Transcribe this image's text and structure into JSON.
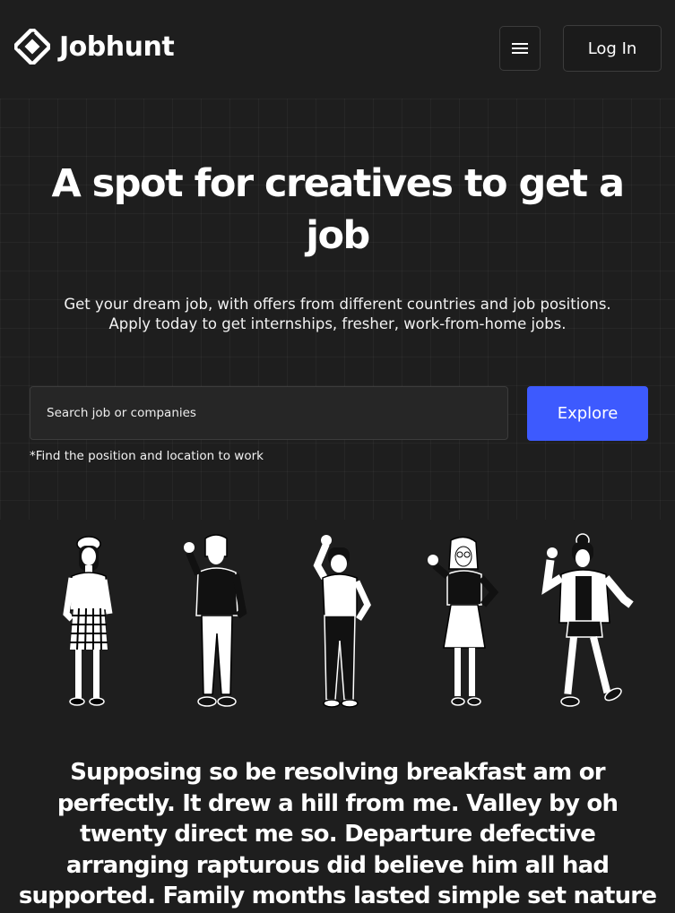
{
  "header": {
    "brand": "Jobhunt",
    "logo_icon": "diamond-logo-icon",
    "menu_icon": "hamburger-icon",
    "login_label": "Log In"
  },
  "hero": {
    "title": "A spot for creatives to get a job",
    "subtitle_line1": "Get your dream job, with offers from different countries and job positions.",
    "subtitle_line2": "Apply today to get internships, fresher, work-from-home jobs."
  },
  "search": {
    "placeholder": "Search job or companies",
    "value": "",
    "button_label": "Explore",
    "hint": "*Find the position and location to work"
  },
  "illustration": {
    "people": [
      "person-beret-plaid-skirt",
      "person-jacket-waving",
      "person-tshirt-waving",
      "person-glasses-skirt",
      "person-bomber-jacket-waving"
    ]
  },
  "body_text": "Supposing so be resolving breakfast am or perfectly. It drew a hill from me. Valley by oh twenty direct me so. Departure defective arranging rapturous did believe him all had supported. Family months lasted simple set nature",
  "colors": {
    "background": "#1e1e1e",
    "accent": "#3d5afe",
    "border": "#3c3c3c"
  }
}
